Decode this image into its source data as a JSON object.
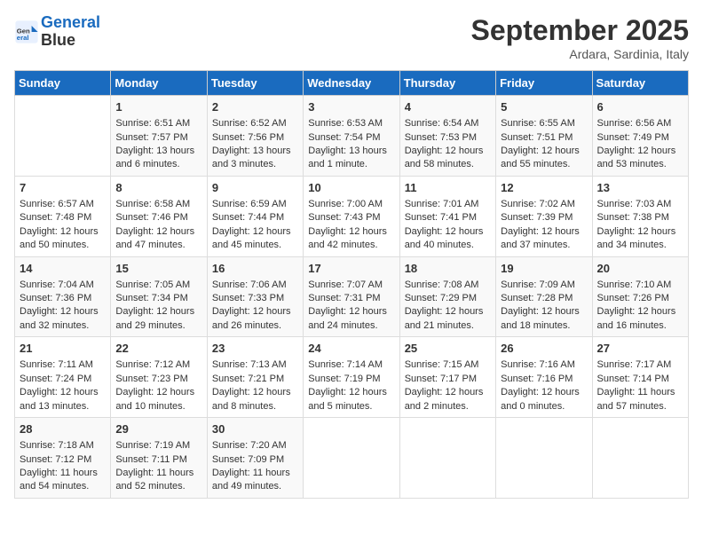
{
  "header": {
    "logo_line1": "General",
    "logo_line2": "Blue",
    "month_title": "September 2025",
    "location": "Ardara, Sardinia, Italy"
  },
  "days_of_week": [
    "Sunday",
    "Monday",
    "Tuesday",
    "Wednesday",
    "Thursday",
    "Friday",
    "Saturday"
  ],
  "weeks": [
    [
      {
        "day": "",
        "info": ""
      },
      {
        "day": "1",
        "info": "Sunrise: 6:51 AM\nSunset: 7:57 PM\nDaylight: 13 hours\nand 6 minutes."
      },
      {
        "day": "2",
        "info": "Sunrise: 6:52 AM\nSunset: 7:56 PM\nDaylight: 13 hours\nand 3 minutes."
      },
      {
        "day": "3",
        "info": "Sunrise: 6:53 AM\nSunset: 7:54 PM\nDaylight: 13 hours\nand 1 minute."
      },
      {
        "day": "4",
        "info": "Sunrise: 6:54 AM\nSunset: 7:53 PM\nDaylight: 12 hours\nand 58 minutes."
      },
      {
        "day": "5",
        "info": "Sunrise: 6:55 AM\nSunset: 7:51 PM\nDaylight: 12 hours\nand 55 minutes."
      },
      {
        "day": "6",
        "info": "Sunrise: 6:56 AM\nSunset: 7:49 PM\nDaylight: 12 hours\nand 53 minutes."
      }
    ],
    [
      {
        "day": "7",
        "info": "Sunrise: 6:57 AM\nSunset: 7:48 PM\nDaylight: 12 hours\nand 50 minutes."
      },
      {
        "day": "8",
        "info": "Sunrise: 6:58 AM\nSunset: 7:46 PM\nDaylight: 12 hours\nand 47 minutes."
      },
      {
        "day": "9",
        "info": "Sunrise: 6:59 AM\nSunset: 7:44 PM\nDaylight: 12 hours\nand 45 minutes."
      },
      {
        "day": "10",
        "info": "Sunrise: 7:00 AM\nSunset: 7:43 PM\nDaylight: 12 hours\nand 42 minutes."
      },
      {
        "day": "11",
        "info": "Sunrise: 7:01 AM\nSunset: 7:41 PM\nDaylight: 12 hours\nand 40 minutes."
      },
      {
        "day": "12",
        "info": "Sunrise: 7:02 AM\nSunset: 7:39 PM\nDaylight: 12 hours\nand 37 minutes."
      },
      {
        "day": "13",
        "info": "Sunrise: 7:03 AM\nSunset: 7:38 PM\nDaylight: 12 hours\nand 34 minutes."
      }
    ],
    [
      {
        "day": "14",
        "info": "Sunrise: 7:04 AM\nSunset: 7:36 PM\nDaylight: 12 hours\nand 32 minutes."
      },
      {
        "day": "15",
        "info": "Sunrise: 7:05 AM\nSunset: 7:34 PM\nDaylight: 12 hours\nand 29 minutes."
      },
      {
        "day": "16",
        "info": "Sunrise: 7:06 AM\nSunset: 7:33 PM\nDaylight: 12 hours\nand 26 minutes."
      },
      {
        "day": "17",
        "info": "Sunrise: 7:07 AM\nSunset: 7:31 PM\nDaylight: 12 hours\nand 24 minutes."
      },
      {
        "day": "18",
        "info": "Sunrise: 7:08 AM\nSunset: 7:29 PM\nDaylight: 12 hours\nand 21 minutes."
      },
      {
        "day": "19",
        "info": "Sunrise: 7:09 AM\nSunset: 7:28 PM\nDaylight: 12 hours\nand 18 minutes."
      },
      {
        "day": "20",
        "info": "Sunrise: 7:10 AM\nSunset: 7:26 PM\nDaylight: 12 hours\nand 16 minutes."
      }
    ],
    [
      {
        "day": "21",
        "info": "Sunrise: 7:11 AM\nSunset: 7:24 PM\nDaylight: 12 hours\nand 13 minutes."
      },
      {
        "day": "22",
        "info": "Sunrise: 7:12 AM\nSunset: 7:23 PM\nDaylight: 12 hours\nand 10 minutes."
      },
      {
        "day": "23",
        "info": "Sunrise: 7:13 AM\nSunset: 7:21 PM\nDaylight: 12 hours\nand 8 minutes."
      },
      {
        "day": "24",
        "info": "Sunrise: 7:14 AM\nSunset: 7:19 PM\nDaylight: 12 hours\nand 5 minutes."
      },
      {
        "day": "25",
        "info": "Sunrise: 7:15 AM\nSunset: 7:17 PM\nDaylight: 12 hours\nand 2 minutes."
      },
      {
        "day": "26",
        "info": "Sunrise: 7:16 AM\nSunset: 7:16 PM\nDaylight: 12 hours\nand 0 minutes."
      },
      {
        "day": "27",
        "info": "Sunrise: 7:17 AM\nSunset: 7:14 PM\nDaylight: 11 hours\nand 57 minutes."
      }
    ],
    [
      {
        "day": "28",
        "info": "Sunrise: 7:18 AM\nSunset: 7:12 PM\nDaylight: 11 hours\nand 54 minutes."
      },
      {
        "day": "29",
        "info": "Sunrise: 7:19 AM\nSunset: 7:11 PM\nDaylight: 11 hours\nand 52 minutes."
      },
      {
        "day": "30",
        "info": "Sunrise: 7:20 AM\nSunset: 7:09 PM\nDaylight: 11 hours\nand 49 minutes."
      },
      {
        "day": "",
        "info": ""
      },
      {
        "day": "",
        "info": ""
      },
      {
        "day": "",
        "info": ""
      },
      {
        "day": "",
        "info": ""
      }
    ]
  ]
}
